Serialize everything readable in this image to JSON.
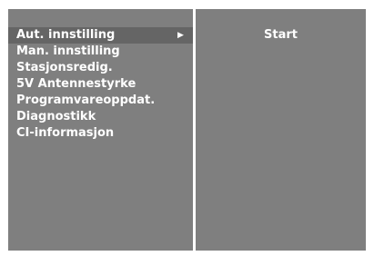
{
  "colors": {
    "panel_background": "#7f7f7f",
    "selected_highlight": "#656565",
    "text": "#ffffff",
    "divider": "#ffffff"
  },
  "menu": {
    "items": [
      {
        "label": "Aut. innstilling",
        "selected": true,
        "has_submenu": true,
        "arrow_icon": "triangle-right-icon"
      },
      {
        "label": "Man. innstilling"
      },
      {
        "label": "Stasjonsredig."
      },
      {
        "label": "5V Antennestyrke"
      },
      {
        "label": "Programvareoppdat."
      },
      {
        "label": "Diagnostikk"
      },
      {
        "label": "CI-informasjon"
      }
    ]
  },
  "submenu": {
    "start_label": "Start"
  }
}
